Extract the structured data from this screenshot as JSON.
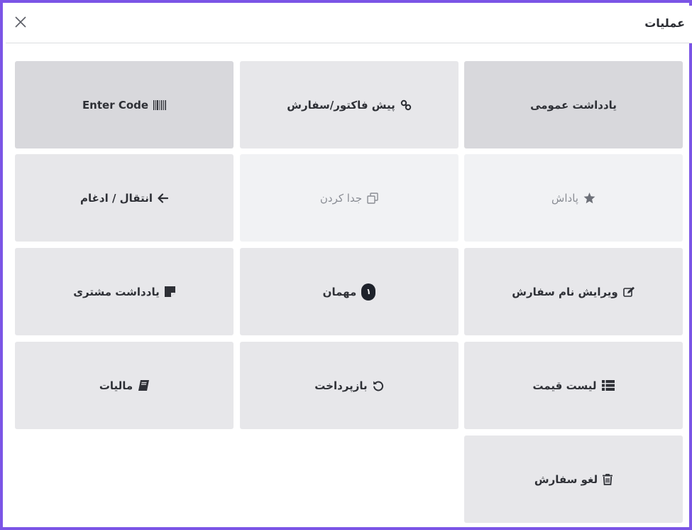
{
  "dialog": {
    "title": "عملیات"
  },
  "tiles": {
    "general_note": {
      "label": "یادداشت عمومی"
    },
    "pre_invoice": {
      "label": "پیش فاکتور/سفارش"
    },
    "enter_code": {
      "label": "Enter Code"
    },
    "reward": {
      "label": "پاداش"
    },
    "split": {
      "label": "جدا کردن"
    },
    "transfer_merge": {
      "label": "انتقال / ادغام"
    },
    "edit_order_name": {
      "label": "ویرایش نام سفارش"
    },
    "guests": {
      "label": "مهمان",
      "count": "۱"
    },
    "customer_note": {
      "label": "یادداشت مشتری"
    },
    "price_list": {
      "label": "لیست قیمت"
    },
    "refund": {
      "label": "بازپرداخت"
    },
    "taxes": {
      "label": "مالیات"
    },
    "cancel_order": {
      "label": "لغو سفارش"
    }
  },
  "colors": {
    "frame_border": "#7b55e6",
    "tile_normal": "#e7e7ea",
    "tile_active": "#d8d8dc",
    "tile_disabled": "#f1f2f4",
    "text": "#2e3036"
  }
}
